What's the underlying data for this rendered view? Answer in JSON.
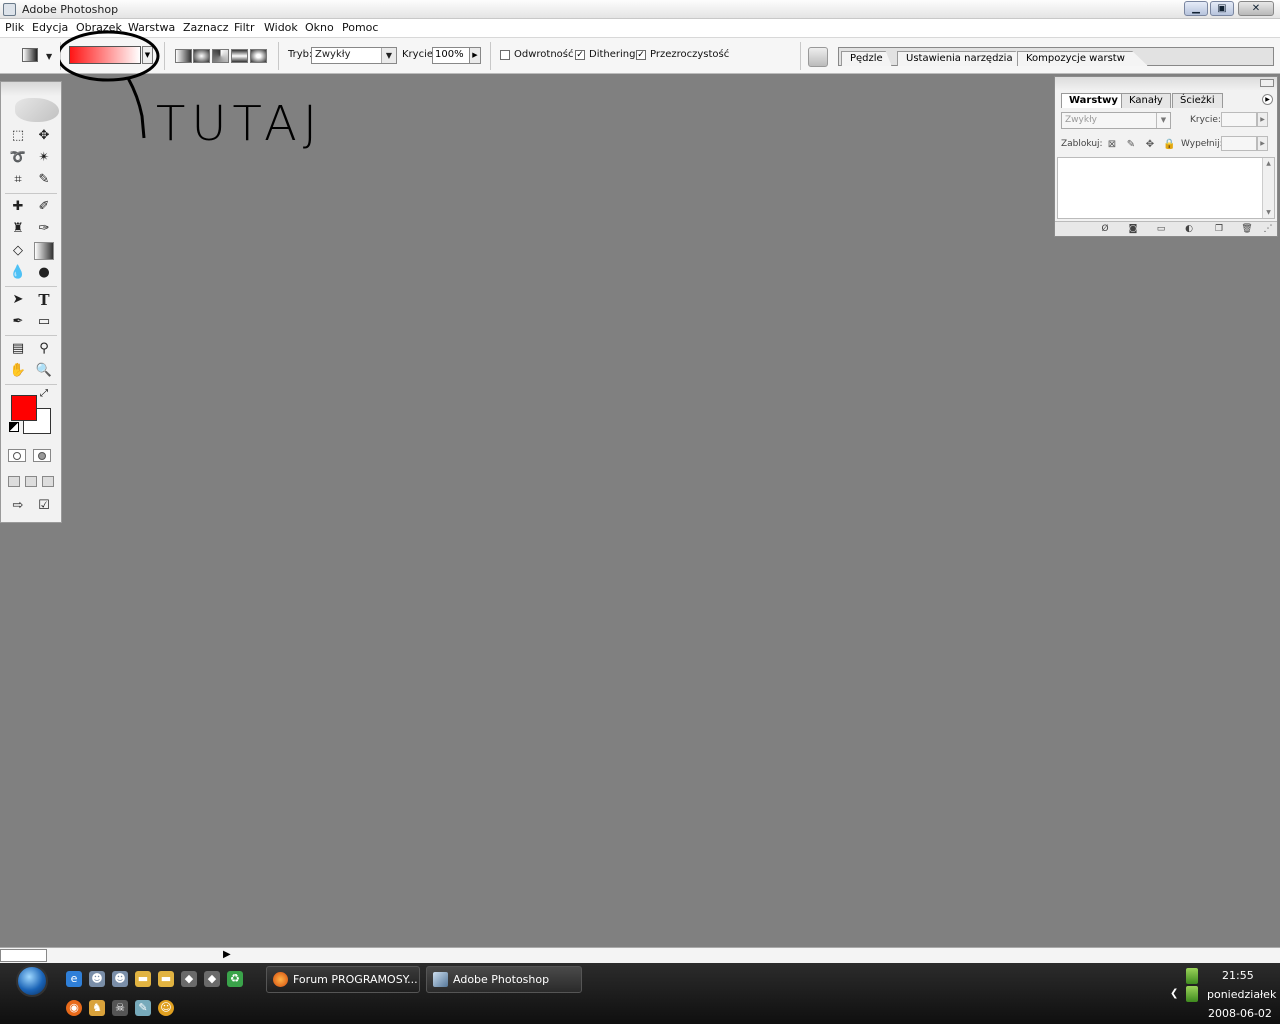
{
  "window": {
    "title": "Adobe Photoshop",
    "buttons": {
      "minimize": "▁",
      "maximize": "▣",
      "close": "✕"
    }
  },
  "menubar": {
    "items": [
      "Plik",
      "Edycja",
      "Obrazek",
      "Warstwa",
      "Zaznacz",
      "Filtr",
      "Widok",
      "Okno",
      "Pomoc"
    ]
  },
  "options": {
    "mode_label": "Tryb:",
    "mode_value": "Zwykły",
    "opacity_label": "Krycie:",
    "opacity_value": "100%",
    "reverse_label": "Odwrotność",
    "reverse_checked": false,
    "dither_label": "Dithering",
    "dither_checked": true,
    "transparency_label": "Przezroczystość",
    "transparency_checked": true,
    "gradient_colors": [
      "#ff1515",
      "#ffffff"
    ]
  },
  "palette_well": {
    "tabs": [
      "Pędzle",
      "Ustawienia narzędzia",
      "Kompozycje warstw"
    ]
  },
  "toolbox": {
    "foreground_color": "#ff0000",
    "background_color": "#ffffff",
    "tools": [
      "marquee-tool",
      "move-tool",
      "lasso-tool",
      "magic-wand-tool",
      "crop-tool",
      "slice-tool",
      "healing-brush-tool",
      "brush-tool",
      "clone-stamp-tool",
      "history-brush-tool",
      "eraser-tool",
      "gradient-tool",
      "blur-tool",
      "dodge-tool",
      "path-selection-tool",
      "type-tool",
      "pen-tool",
      "shape-tool",
      "notes-tool",
      "eyedropper-tool",
      "hand-tool",
      "zoom-tool"
    ],
    "active_tool": "gradient-tool"
  },
  "layers_panel": {
    "tabs": [
      "Warstwy",
      "Kanały",
      "Ścieżki"
    ],
    "active_tab": "Warstwy",
    "blend_mode": "Zwykły",
    "opacity_label": "Krycie:",
    "lock_label": "Zablokuj:",
    "fill_label": "Wypełnij:"
  },
  "annotation": {
    "text": "TUTAJ",
    "color": "#000000"
  },
  "taskbar": {
    "tasks": [
      {
        "label": "Forum PROGRAMOSY...",
        "icon": "firefox-icon"
      },
      {
        "label": "Adobe Photoshop",
        "icon": "photoshop-icon"
      }
    ],
    "clock": "21:55",
    "day": "poniedziałek",
    "date": "2008-06-02"
  }
}
